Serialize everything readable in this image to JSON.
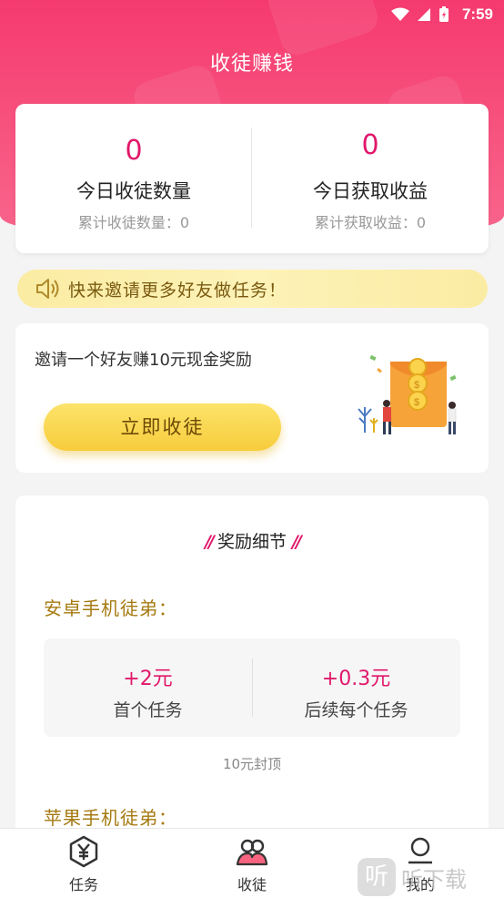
{
  "status_bar": {
    "time": "7:59"
  },
  "header": {
    "title": "收徒赚钱"
  },
  "stats": {
    "left": {
      "value": "0",
      "label": "今日收徒数量",
      "sub": "累计收徒数量：0"
    },
    "right": {
      "value": "0",
      "label": "今日获取收益",
      "sub": "累计获取收益：0"
    }
  },
  "notice": {
    "text": "快来邀请更多好友做任务！",
    "icon": "speaker-icon"
  },
  "invite": {
    "text": "邀请一个好友赚10元现金奖励",
    "button": "立即收徒",
    "illustration": "red-envelope-illustration"
  },
  "rewards": {
    "title": "奖励细节",
    "android": {
      "title": "安卓手机徒弟：",
      "first": {
        "amount": "+2元",
        "desc": "首个任务"
      },
      "each": {
        "amount": "+0.3元",
        "desc": "后续每个任务"
      },
      "cap": "10元封顶"
    },
    "apple": {
      "title": "苹果手机徒弟："
    }
  },
  "tabbar": {
    "items": [
      {
        "label": "任务",
        "icon": "yen-hexagon-icon"
      },
      {
        "label": "收徒",
        "icon": "users-icon"
      },
      {
        "label": "我的",
        "icon": "profile-icon"
      }
    ]
  },
  "watermark": {
    "logo": "听",
    "text": "听下载"
  },
  "colors": {
    "accent": "#e0186a",
    "header": "#f53a6f",
    "button": "#f9d64c",
    "section_title": "#a57a12"
  }
}
